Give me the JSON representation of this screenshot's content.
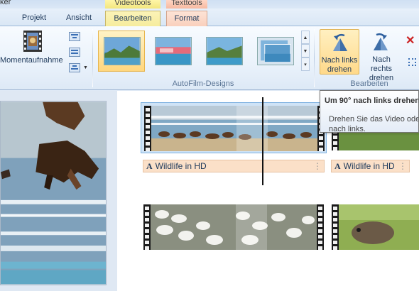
{
  "app": {
    "title_fragment": "ker"
  },
  "context_tabs": {
    "video": "Videotools",
    "text": "Texttools"
  },
  "tabs": [
    {
      "label": "Projekt"
    },
    {
      "label": "Ansicht"
    },
    {
      "label": "Bearbeiten"
    },
    {
      "label": "Format"
    }
  ],
  "ribbon": {
    "snapshot_label": "Momentaufnahme",
    "themes_group": "AutoFilm-Designs",
    "edit_group": "Bearbeiten",
    "rotate_left": {
      "line1": "Nach links",
      "line2": "drehen"
    },
    "rotate_right": {
      "line1": "Nach rechts",
      "line2": "drehen"
    }
  },
  "tooltip": {
    "title": "Um 90° nach links drehen",
    "body_line1": "Drehen Sie das Video ode",
    "body_line2": "nach links."
  },
  "clips": [
    {
      "caption": "Wildlife in HD"
    },
    {
      "caption": "Wildlife in HD"
    }
  ],
  "colors": {
    "selected_theme": "#ffd77e",
    "caption_bg": "#fbe0c8",
    "ribbon_bg": "#eaf2fb"
  }
}
